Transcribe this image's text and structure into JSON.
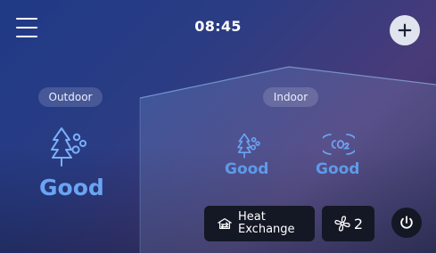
{
  "header": {
    "time": "08:45",
    "menu_icon": "hamburger-menu-icon",
    "add_icon": "plus-icon"
  },
  "outdoor": {
    "label": "Outdoor",
    "icon": "tree-air-icon",
    "status": "Good"
  },
  "indoor": {
    "label": "Indoor",
    "air_quality": {
      "icon": "tree-air-icon",
      "status": "Good"
    },
    "co2": {
      "icon": "co2-icon",
      "status": "Good"
    }
  },
  "controls": {
    "mode": {
      "icon": "heat-exchange-icon",
      "line1": "Heat",
      "line2": "Exchange"
    },
    "fan": {
      "icon": "fan-icon",
      "level": "2"
    },
    "power": {
      "icon": "power-icon"
    }
  },
  "colors": {
    "status_good": "#6aa4f3",
    "button_dark": "#141824",
    "add_button_bg": "#dfe4ee"
  }
}
